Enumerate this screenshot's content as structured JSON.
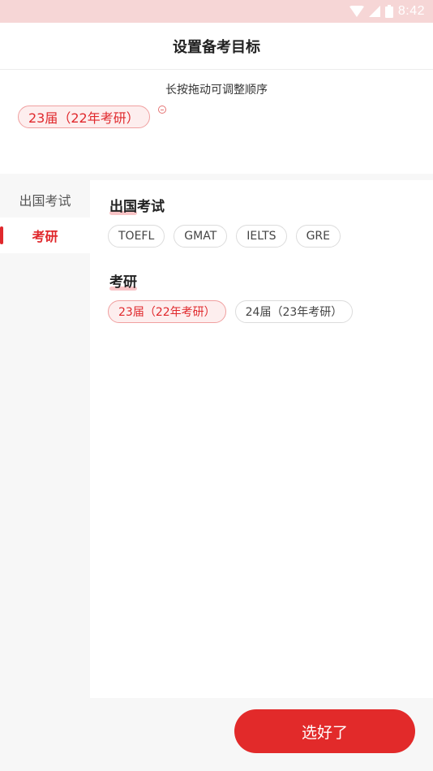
{
  "status_bar": {
    "time": "8:42"
  },
  "header": {
    "title": "设置备考目标"
  },
  "selected": {
    "hint": "长按拖动可调整顺序",
    "chips": [
      "23届（22年考研）"
    ]
  },
  "sidebar": {
    "items": [
      {
        "label": "出国考试"
      },
      {
        "label": "考研"
      }
    ]
  },
  "sections": [
    {
      "title": "出国考试",
      "options": [
        {
          "label": "TOEFL"
        },
        {
          "label": "GMAT"
        },
        {
          "label": "IELTS"
        },
        {
          "label": "GRE"
        }
      ]
    },
    {
      "title": "考研",
      "options": [
        {
          "label": "23届（22年考研）"
        },
        {
          "label": "24届（23年考研）"
        }
      ]
    }
  ],
  "footer": {
    "confirm_label": "选好了"
  },
  "colors": {
    "accent": "#e22a2a",
    "chip_selected_bg": "#fdeeee",
    "status_bar": "#f6d6d6"
  }
}
